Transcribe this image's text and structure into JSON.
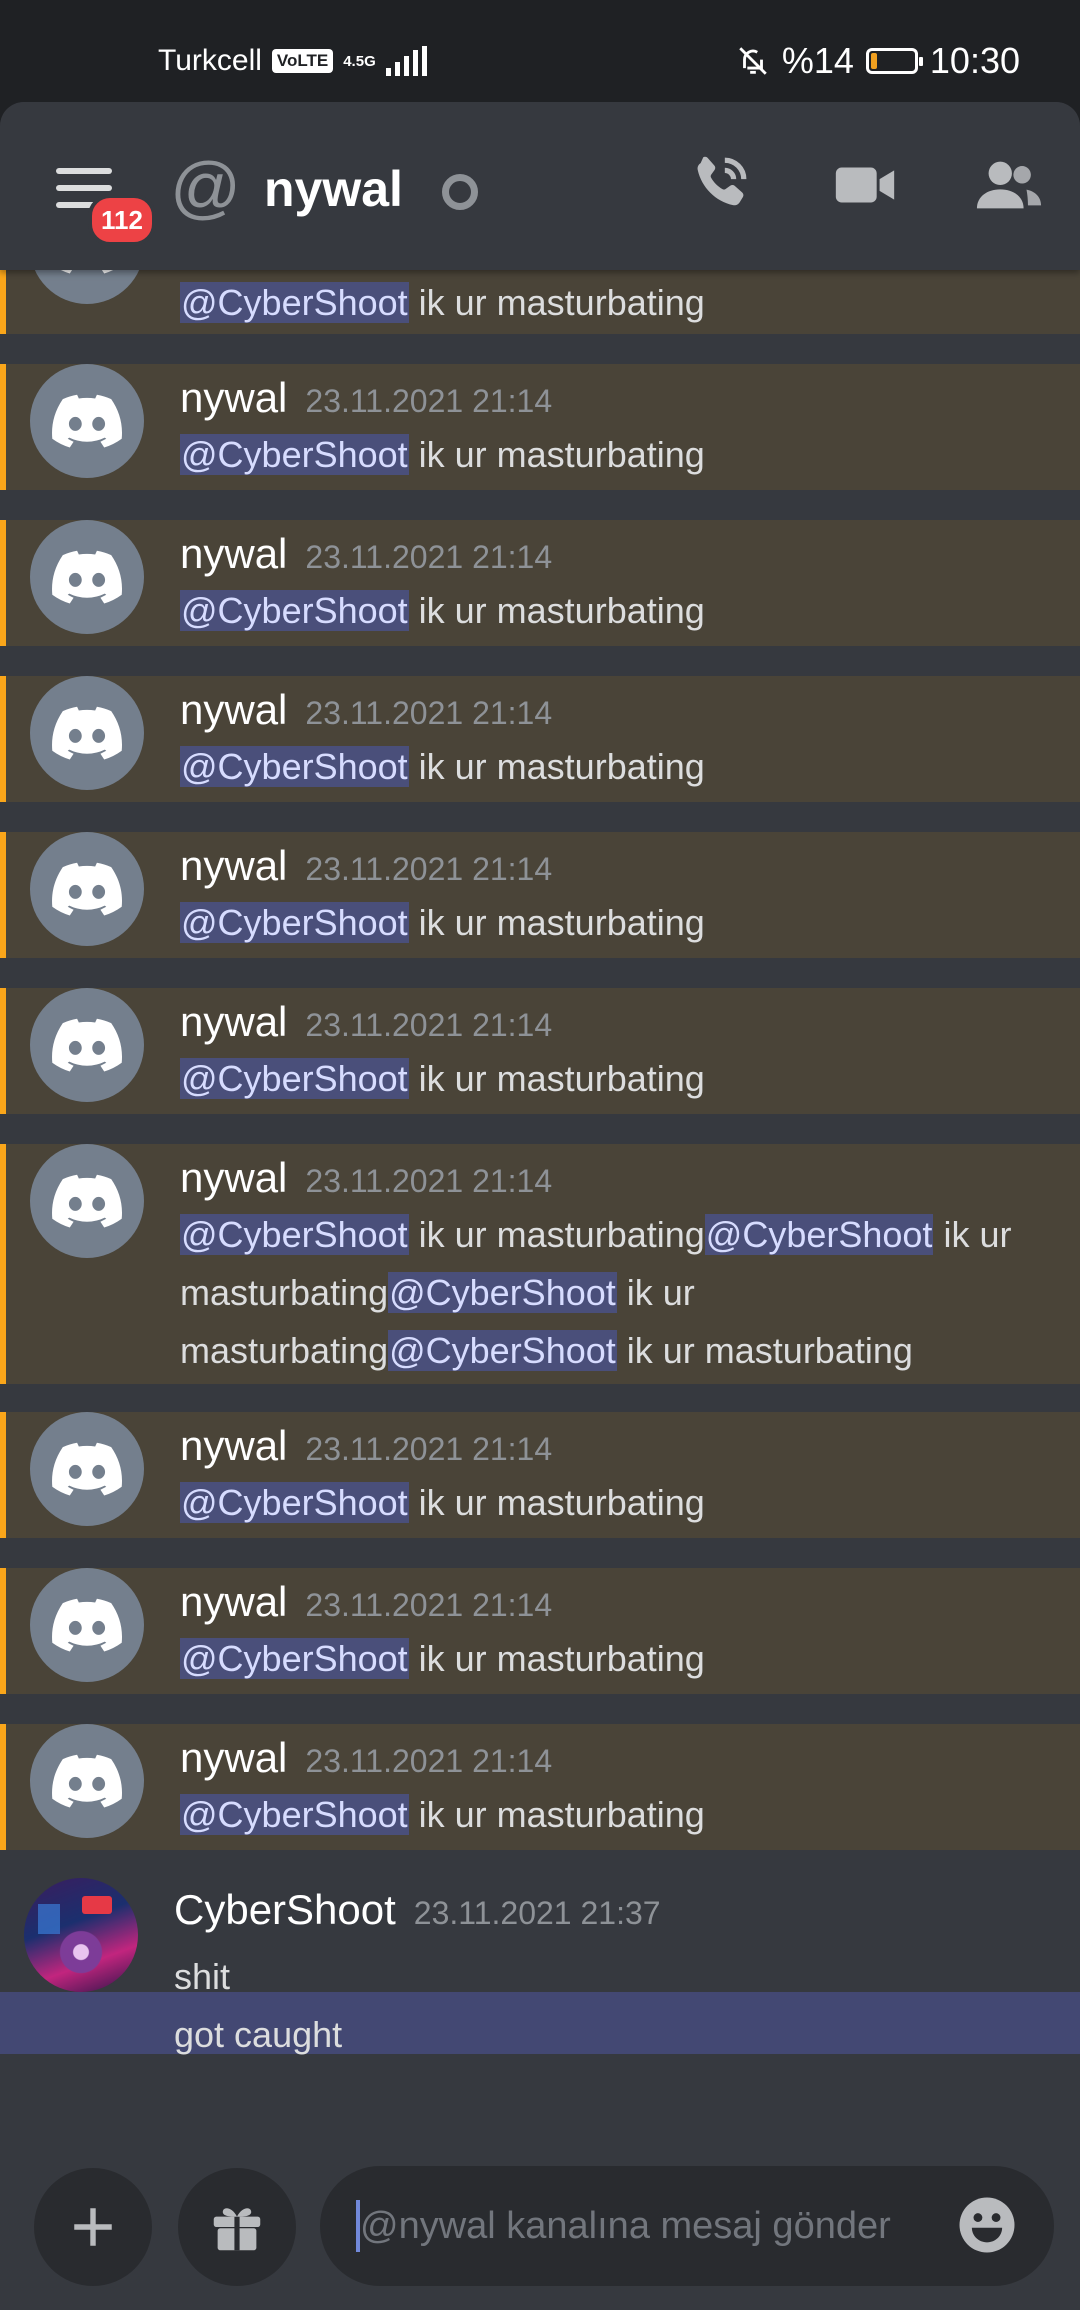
{
  "status_bar": {
    "carrier": "Turkcell",
    "volte": "VoLTE",
    "network": "4.5G",
    "battery_text": "%14",
    "battery_level": 0.14,
    "time": "10:30"
  },
  "header": {
    "unread_badge": "112",
    "at_symbol": "@",
    "title": "nywal"
  },
  "messages": [
    {
      "author": "nywal",
      "timestamp": "23.11.2021 21:14",
      "parts": [
        {
          "mention": "@CyberShoot"
        },
        {
          "text": " ik ur masturbating"
        }
      ]
    },
    {
      "author": "nywal",
      "timestamp": "23.11.2021 21:14",
      "parts": [
        {
          "mention": "@CyberShoot"
        },
        {
          "text": " ik ur masturbating"
        }
      ]
    },
    {
      "author": "nywal",
      "timestamp": "23.11.2021 21:14",
      "parts": [
        {
          "mention": "@CyberShoot"
        },
        {
          "text": " ik ur masturbating"
        }
      ]
    },
    {
      "author": "nywal",
      "timestamp": "23.11.2021 21:14",
      "parts": [
        {
          "mention": "@CyberShoot"
        },
        {
          "text": " ik ur masturbating"
        }
      ]
    },
    {
      "author": "nywal",
      "timestamp": "23.11.2021 21:14",
      "parts": [
        {
          "mention": "@CyberShoot"
        },
        {
          "text": " ik ur masturbating"
        }
      ]
    },
    {
      "author": "nywal",
      "timestamp": "23.11.2021 21:14",
      "parts": [
        {
          "mention": "@CyberShoot"
        },
        {
          "text": " ik ur masturbating"
        },
        {
          "mention": "@CyberShoot"
        },
        {
          "text": " ik ur masturbating"
        },
        {
          "mention": "@CyberShoot"
        },
        {
          "text": " ik ur masturbating"
        },
        {
          "mention": "@CyberShoot"
        },
        {
          "text": " ik ur masturbating"
        }
      ]
    },
    {
      "author": "nywal",
      "timestamp": "23.11.2021 21:14",
      "parts": [
        {
          "mention": "@CyberShoot"
        },
        {
          "text": " ik ur masturbating"
        }
      ]
    },
    {
      "author": "nywal",
      "timestamp": "23.11.2021 21:14",
      "parts": [
        {
          "mention": "@CyberShoot"
        },
        {
          "text": " ik ur masturbating"
        }
      ]
    },
    {
      "author": "nywal",
      "timestamp": "23.11.2021 21:14",
      "parts": [
        {
          "mention": "@CyberShoot"
        },
        {
          "text": " ik ur masturbating"
        }
      ]
    }
  ],
  "partial_message": {
    "parts": [
      {
        "mention": "@CyberShoot"
      },
      {
        "text": " ik ur masturbating"
      }
    ]
  },
  "last_message": {
    "author": "CyberShoot",
    "timestamp": "23.11.2021 21:37",
    "lines": [
      "shit",
      "got caught"
    ]
  },
  "composer": {
    "placeholder": "@nywal kanalına mesaj gönder"
  },
  "icons": [
    "menu-icon",
    "at-icon",
    "status-idle-icon",
    "call-icon",
    "video-icon",
    "members-icon",
    "discord-logo-icon",
    "plus-icon",
    "gift-icon",
    "emoji-icon"
  ],
  "colors": {
    "mention_bg": "#4a4438",
    "mention_bar": "#faa61a",
    "mention_tag": "#4a4f7a",
    "badge": "#ed4245",
    "app_bg": "#36393f"
  }
}
